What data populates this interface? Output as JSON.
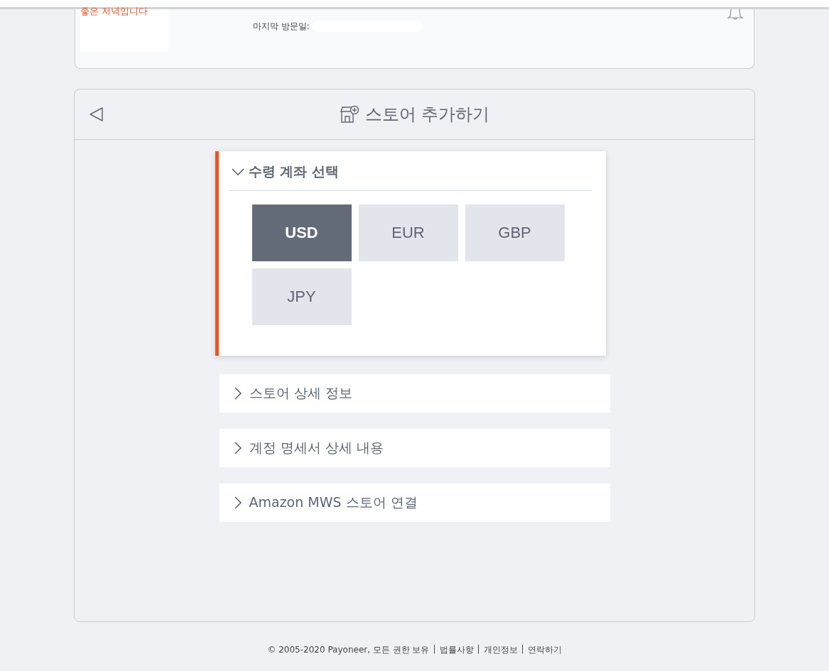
{
  "profile": {
    "greeting": "좋은 저녁입니다",
    "last_visit_label": "마지막 방문일:"
  },
  "store_card": {
    "title": "스토어 추가하기",
    "sections": [
      {
        "title": "수령 계좌 선택",
        "expanded": true,
        "currencies": [
          {
            "label": "USD",
            "selected": true
          },
          {
            "label": "EUR",
            "selected": false
          },
          {
            "label": "GBP",
            "selected": false
          },
          {
            "label": "JPY",
            "selected": false
          }
        ]
      },
      {
        "title": "스토어 상세 정보",
        "expanded": false
      },
      {
        "title": "계정 명세서 상세 내용",
        "expanded": false
      },
      {
        "title": "Amazon MWS 스토어 연결",
        "expanded": false
      }
    ]
  },
  "footer": {
    "copyright": "© 2005-2020 Payoneer, 모든 권한 보유",
    "links": [
      {
        "separator": "|",
        "label": "법률사항"
      },
      {
        "separator": "|",
        "label": "개인정보"
      },
      {
        "separator": "|",
        "label": "연락하기"
      }
    ]
  }
}
